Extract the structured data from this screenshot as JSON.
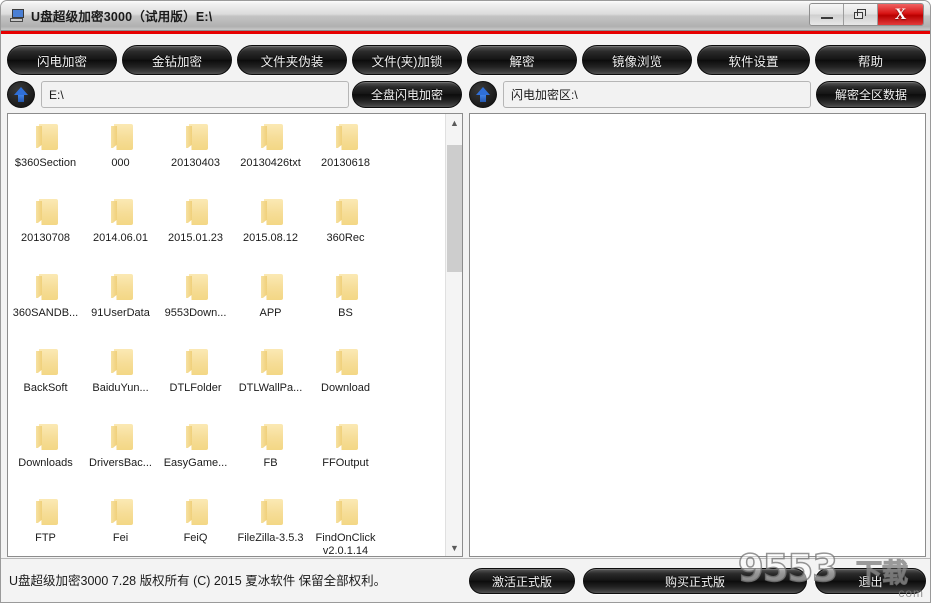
{
  "window": {
    "title": "U盘超级加密3000（试用版）E:\\",
    "icon": "computer-icon",
    "controls": {
      "minimize": "minimize-icon",
      "restore": "restore-icon",
      "close": "X"
    },
    "accent_color": "#e60000"
  },
  "toolbar": {
    "buttons": [
      {
        "label": "闪电加密",
        "name": "flash-encrypt-button"
      },
      {
        "label": "金钻加密",
        "name": "diamond-encrypt-button"
      },
      {
        "label": "文件夹伪装",
        "name": "folder-disguise-button"
      },
      {
        "label": "文件(夹)加锁",
        "name": "file-folder-lock-button"
      },
      {
        "label": "解密",
        "name": "decrypt-button"
      },
      {
        "label": "镜像浏览",
        "name": "mirror-browse-button"
      },
      {
        "label": "软件设置",
        "name": "settings-button"
      },
      {
        "label": "帮助",
        "name": "help-button"
      }
    ]
  },
  "left_pane": {
    "path_value": "E:\\",
    "path_placeholder": "E:\\",
    "up_button": "up-arrow-icon",
    "action_button": "全盘闪电加密",
    "scroll": {
      "thumb_top_pct": 3.5,
      "thumb_height_pct": 31
    },
    "items": [
      "$360Section",
      "000",
      "20130403",
      "20130426txt",
      "20130618",
      "20130708",
      "2014.06.01",
      "2015.01.23",
      "2015.08.12",
      "360Rec",
      "360SANDB...",
      "91UserData",
      "9553Down...",
      "APP",
      "BS",
      "BackSoft",
      "BaiduYun...",
      "DTLFolder",
      "DTLWallPa...",
      "Download",
      "Downloads",
      "DriversBac...",
      "EasyGame...",
      "FB",
      "FFOutput",
      "FTP",
      "Fei",
      "FeiQ",
      "FileZilla-3.5.3",
      "FindOnClick v2.0.1.14"
    ]
  },
  "right_pane": {
    "path_value": "闪电加密区:\\",
    "path_placeholder": "闪电加密区:\\",
    "up_button": "up-arrow-icon",
    "action_button": "解密全区数据",
    "items": []
  },
  "status": {
    "text": "U盘超级加密3000  7.28 版权所有 (C) 2015 夏冰软件 保留全部权利。",
    "buttons": [
      {
        "label": "激活正式版",
        "name": "activate-button"
      },
      {
        "label": "购买正式版",
        "name": "purchase-button"
      },
      {
        "label": "退出",
        "name": "exit-button"
      }
    ]
  },
  "watermark": {
    "digits": "9553",
    "chinese": "下载",
    "domain": "com"
  }
}
